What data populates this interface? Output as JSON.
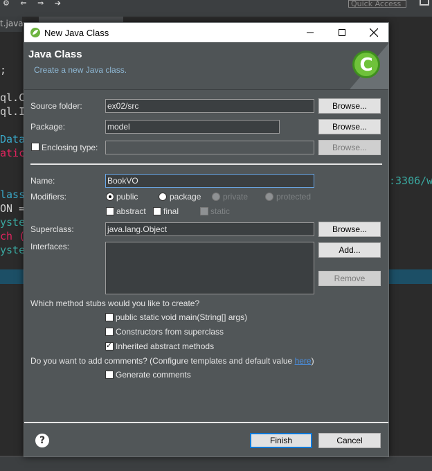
{
  "ide": {
    "quick_access": "Quick Access",
    "left_tab": "t.java",
    "code_left": [
      ";",
      "",
      "ql.C",
      "ql.I",
      "",
      "Data",
      "atic",
      "",
      "",
      "lass",
      "ON =",
      "yste",
      "ch (",
      "yste"
    ],
    "code_right": ":3306/w"
  },
  "dialog": {
    "title": "New Java Class",
    "banner_title": "Java Class",
    "banner_desc": "Create a new Java class.",
    "source_folder": {
      "label": "Source folder:",
      "value": "ex02/src",
      "button": "Browse..."
    },
    "package": {
      "label": "Package:",
      "value": "model",
      "button": "Browse..."
    },
    "enclosing": {
      "label": "Enclosing type:",
      "value": "",
      "button": "Browse..."
    },
    "name": {
      "label": "Name:",
      "value": "BookVO"
    },
    "modifiers": {
      "label": "Modifiers:",
      "public": "public",
      "package": "package",
      "private": "private",
      "protected": "protected",
      "abstract": "abstract",
      "final": "final",
      "static": "static"
    },
    "superclass": {
      "label": "Superclass:",
      "value": "java.lang.Object",
      "button": "Browse..."
    },
    "interfaces": {
      "label": "Interfaces:",
      "add": "Add...",
      "remove": "Remove"
    },
    "stubs": {
      "question": "Which method stubs would you like to create?",
      "main": "public static void main(String[] args)",
      "constructors": "Constructors from superclass",
      "inherited": "Inherited abstract methods"
    },
    "comments": {
      "question_prefix": "Do you want to add comments? (Configure templates and default value ",
      "link": "here",
      "question_suffix": ")",
      "generate": "Generate comments"
    },
    "finish": "Finish",
    "cancel": "Cancel"
  }
}
